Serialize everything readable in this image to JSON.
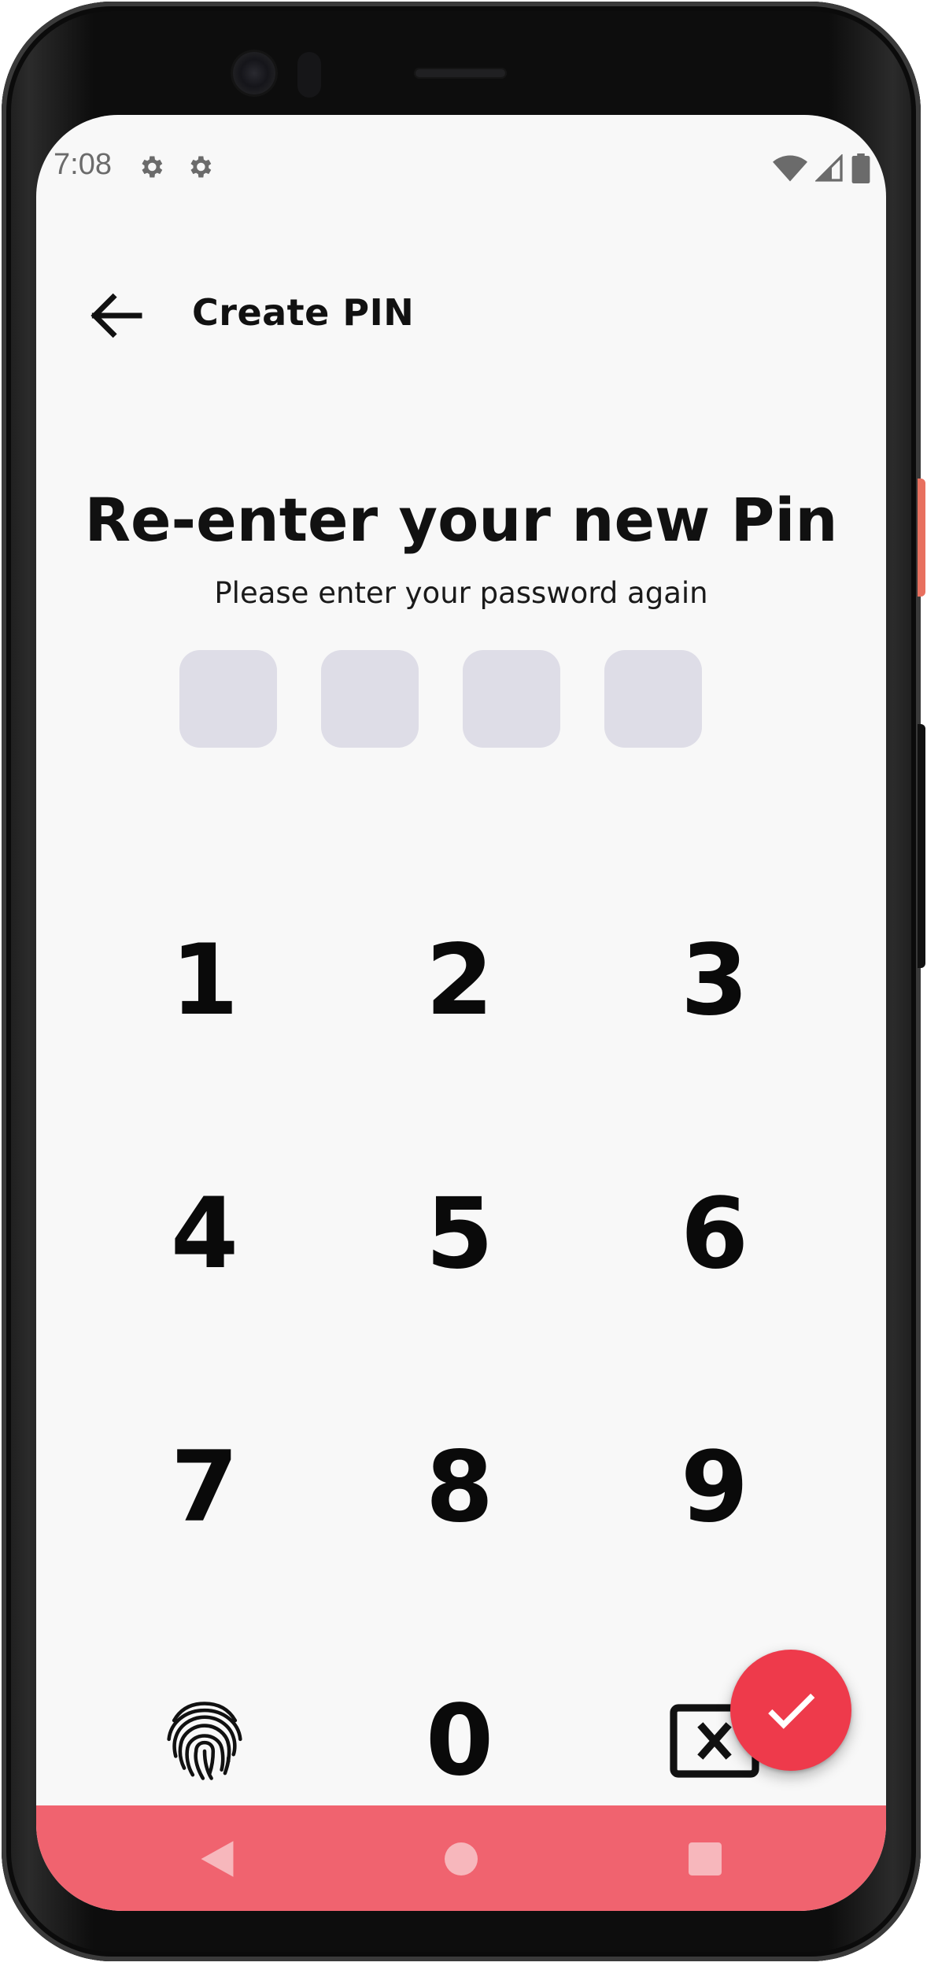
{
  "status_bar": {
    "time": "7:08",
    "icons": [
      "settings-gear-icon",
      "settings-gear-icon",
      "wifi-icon",
      "cell-signal-icon",
      "battery-icon"
    ]
  },
  "app_bar": {
    "back_icon": "arrow-left-icon",
    "title": "Create PIN"
  },
  "main": {
    "heading": "Re-enter your new Pin",
    "subheading": "Please enter your password again",
    "pin_slots": 4
  },
  "keypad": {
    "keys": [
      "1",
      "2",
      "3",
      "4",
      "5",
      "6",
      "7",
      "8",
      "9",
      "0"
    ],
    "left_action_icon": "fingerprint-icon",
    "right_action_icon": "backspace-icon"
  },
  "fab": {
    "icon": "checkmark-icon"
  },
  "nav_bar": {
    "buttons": [
      "back-triangle-icon",
      "home-circle-icon",
      "recents-square-icon"
    ]
  },
  "colors": {
    "accent": "#ee3a4b",
    "nav_bar": "#f0636f",
    "pin_box": "#dedde7",
    "screen_bg": "#f8f8f8",
    "side_button_accent": "#e8705f"
  }
}
